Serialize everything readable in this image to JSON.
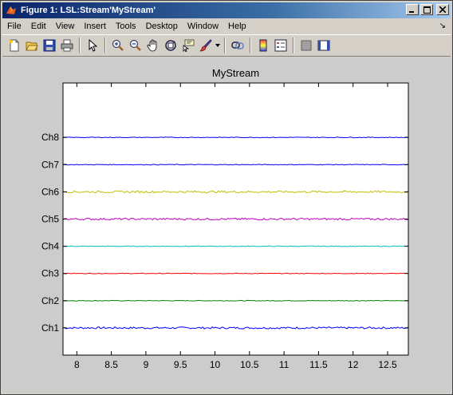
{
  "window": {
    "title": "Figure 1: LSL:Stream'MyStream'"
  },
  "menu": {
    "items": [
      "File",
      "Edit",
      "View",
      "Insert",
      "Tools",
      "Desktop",
      "Window",
      "Help"
    ],
    "dock_arrow": "↘"
  },
  "toolbar": {
    "buttons": [
      "new-figure-icon",
      "open-file-icon",
      "save-icon",
      "print-icon",
      "arrow-pointer-icon",
      "zoom-in-icon",
      "zoom-out-icon",
      "pan-hand-icon",
      "rotate-3d-icon",
      "data-cursor-icon",
      "brush-icon",
      "link-plot-icon",
      "colorbar-icon",
      "legend-icon",
      "hide-plot-tools-icon",
      "show-plot-tools-icon"
    ]
  },
  "colors": {
    "figure_bg": "#cccccc",
    "axes_bg": "#ffffff",
    "title_bar_start": "#0a246a",
    "title_bar_end": "#a6caf0"
  },
  "chart_data": {
    "type": "line",
    "title": "MyStream",
    "xlabel": "",
    "ylabel": "",
    "xlim": [
      7.8,
      12.8
    ],
    "ylim": [
      0,
      10
    ],
    "x_ticks": [
      8,
      8.5,
      9,
      9.5,
      10,
      10.5,
      11,
      11.5,
      12,
      12.5
    ],
    "x_tick_labels": [
      "8",
      "8.5",
      "9",
      "9.5",
      "10",
      "10.5",
      "11",
      "11.5",
      "12",
      "12.5"
    ],
    "y_ticks": [
      1,
      2,
      3,
      4,
      5,
      6,
      7,
      8
    ],
    "y_tick_labels": [
      "Ch1",
      "Ch2",
      "Ch3",
      "Ch4",
      "Ch5",
      "Ch6",
      "Ch7",
      "Ch8"
    ],
    "grid": false,
    "series": [
      {
        "name": "Ch1",
        "offset": 1,
        "color": "#0000ff"
      },
      {
        "name": "Ch2",
        "offset": 2,
        "color": "#008000"
      },
      {
        "name": "Ch3",
        "offset": 3,
        "color": "#ff0000"
      },
      {
        "name": "Ch4",
        "offset": 4,
        "color": "#00bfbf"
      },
      {
        "name": "Ch5",
        "offset": 5,
        "color": "#bf00bf"
      },
      {
        "name": "Ch6",
        "offset": 6,
        "color": "#bfbf00"
      },
      {
        "name": "Ch7",
        "offset": 7,
        "color": "#0000ff"
      },
      {
        "name": "Ch8",
        "offset": 8,
        "color": "#0000ff"
      }
    ]
  }
}
